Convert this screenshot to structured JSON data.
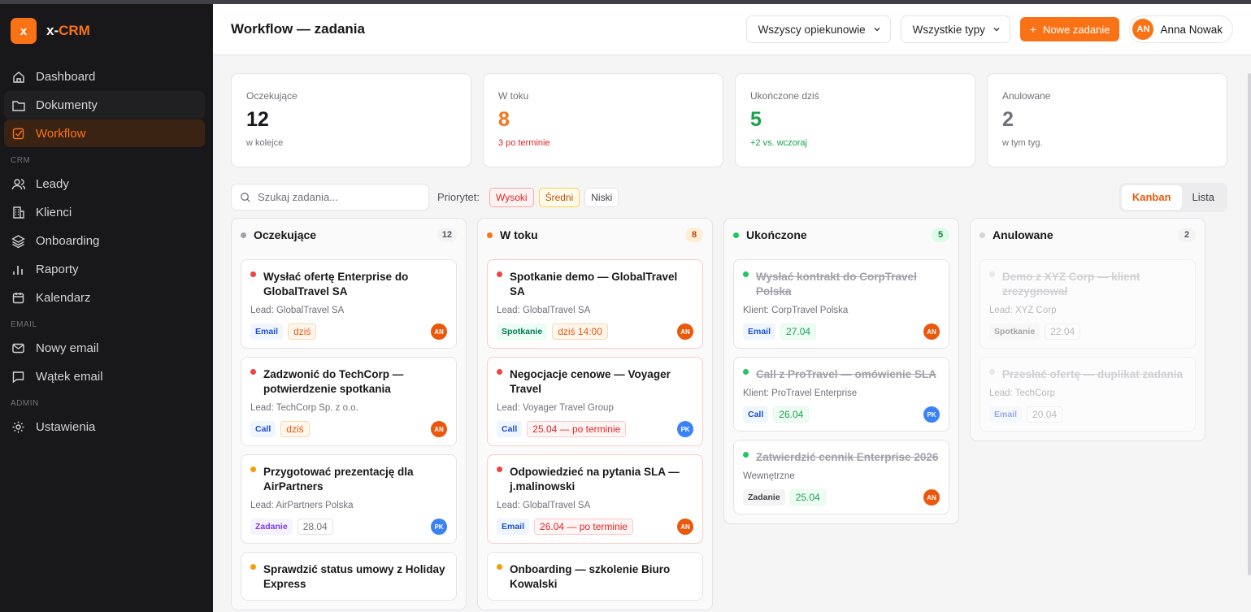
{
  "brand": {
    "logo": "x",
    "name_prefix": "x-",
    "name_accent": "CRM"
  },
  "sidebar": {
    "items": [
      {
        "label": "Dashboard",
        "icon": "home-icon"
      },
      {
        "label": "Dokumenty",
        "icon": "folder-icon"
      },
      {
        "label": "Workflow",
        "icon": "checkbox-icon",
        "active": true
      }
    ],
    "crm_section": "CRM",
    "crm_items": [
      {
        "label": "Leady",
        "icon": "users-icon"
      },
      {
        "label": "Klienci",
        "icon": "building-icon"
      },
      {
        "label": "Onboarding",
        "icon": "layers-icon"
      },
      {
        "label": "Raporty",
        "icon": "bar-chart-icon"
      },
      {
        "label": "Kalendarz",
        "icon": "calendar-icon"
      }
    ],
    "email_section": "EMAIL",
    "email_items": [
      {
        "label": "Nowy email",
        "icon": "mail-icon"
      },
      {
        "label": "Wątek email",
        "icon": "message-icon"
      }
    ],
    "admin_section": "ADMIN",
    "admin_items": [
      {
        "label": "Ustawienia",
        "icon": "gear-icon"
      }
    ]
  },
  "header": {
    "title": "Workflow — zadania",
    "filter_owner": "Wszyscy opiekunowie",
    "filter_type": "Wszystkie typy",
    "new_button": "Nowe zadanie",
    "user_initials": "AN",
    "user_name": "Anna Nowak"
  },
  "stats": [
    {
      "label": "Oczekujące",
      "value": "12",
      "sub": "w kolejce",
      "color": "#18181b",
      "sub_color": "#71717a"
    },
    {
      "label": "W toku",
      "value": "8",
      "sub": "3 po terminie",
      "color": "#f97316",
      "sub_color": "#dc2626"
    },
    {
      "label": "Ukończone dziś",
      "value": "5",
      "sub": "+2 vs. wczoraj",
      "color": "#16a34a",
      "sub_color": "#16a34a"
    },
    {
      "label": "Anulowane",
      "value": "2",
      "sub": "w tym tyg.",
      "color": "#71717a",
      "sub_color": "#71717a"
    }
  ],
  "filters": {
    "search_placeholder": "Szukaj zadania...",
    "priority_label": "Priorytet:",
    "priority_high": "Wysoki",
    "priority_mid": "Średni",
    "priority_low": "Niski",
    "view_kanban": "Kanban",
    "view_list": "Lista"
  },
  "columns": [
    {
      "title": "Oczekujące",
      "count": "12",
      "dot": "#a1a1aa",
      "count_bg": "#f4f4f5",
      "count_fg": "#52525b",
      "cards": [
        {
          "title": "Wysłać ofertę Enterprise do GlobalTravel SA",
          "prio": "#ef4444",
          "sub": "Lead: GlobalTravel SA",
          "tag": "Email",
          "tag_cls": "email",
          "date": "dziś",
          "date_cls": "orange",
          "avatar": "AN"
        },
        {
          "title": "Zadzwonić do TechCorp — potwierdzenie spotkania",
          "prio": "#ef4444",
          "sub": "Lead: TechCorp Sp. z o.o.",
          "tag": "Call",
          "tag_cls": "call",
          "date": "dziś",
          "date_cls": "orange",
          "avatar": "AN"
        },
        {
          "title": "Przygotować prezentację dla AirPartners",
          "prio": "#f59e0b",
          "sub": "Lead: AirPartners Polska",
          "tag": "Zadanie",
          "tag_cls": "task",
          "date": "28.04",
          "date_cls": "",
          "avatar": "PK"
        },
        {
          "title": "Sprawdzić status umowy z Holiday Express",
          "prio": "#f59e0b",
          "sub": "",
          "tag": "",
          "tag_cls": "",
          "date": "",
          "date_cls": "",
          "avatar": ""
        }
      ]
    },
    {
      "title": "W toku",
      "count": "8",
      "dot": "#f97316",
      "count_bg": "#ffedd5",
      "count_fg": "#c2410c",
      "cards": [
        {
          "title": "Spotkanie demo — GlobalTravel SA",
          "prio": "#ef4444",
          "sub": "Lead: GlobalTravel SA",
          "tag": "Spotkanie",
          "tag_cls": "meet",
          "date": "dziś 14:00",
          "date_cls": "orange",
          "avatar": "AN",
          "urgent": true
        },
        {
          "title": "Negocjacje cenowe — Voyager Travel",
          "prio": "#ef4444",
          "sub": "Lead: Voyager Travel Group",
          "tag": "Call",
          "tag_cls": "call",
          "date": "25.04 — po terminie",
          "date_cls": "red",
          "avatar": "PK",
          "urgent": true
        },
        {
          "title": "Odpowiedzieć na pytania SLA — j.malinowski",
          "prio": "#ef4444",
          "sub": "Lead: GlobalTravel SA",
          "tag": "Email",
          "tag_cls": "email",
          "date": "26.04 — po terminie",
          "date_cls": "red",
          "avatar": "AN",
          "urgent": true
        },
        {
          "title": "Onboarding — szkolenie Biuro Kowalski",
          "prio": "#f59e0b",
          "sub": "",
          "tag": "",
          "tag_cls": "",
          "date": "",
          "date_cls": "",
          "avatar": ""
        }
      ]
    },
    {
      "title": "Ukończone",
      "count": "5",
      "dot": "#22c55e",
      "count_bg": "#dcfce7",
      "count_fg": "#15803d",
      "cards": [
        {
          "title": "Wysłać kontrakt do CorpTravel Polska",
          "prio": "#22c55e",
          "sub": "Klient: CorpTravel Polska",
          "tag": "Email",
          "tag_cls": "email",
          "date": "27.04",
          "date_cls": "green",
          "avatar": "AN",
          "done": true
        },
        {
          "title": "Call z ProTravel — omówienie SLA",
          "prio": "#22c55e",
          "sub": "Klient: ProTravel Enterprise",
          "tag": "Call",
          "tag_cls": "call",
          "date": "26.04",
          "date_cls": "green",
          "avatar": "PK",
          "done": true
        },
        {
          "title": "Zatwierdzić cennik Enterprise 2026",
          "prio": "#22c55e",
          "sub": "Wewnętrzne",
          "tag": "Zadanie",
          "tag_cls": "int",
          "date": "25.04",
          "date_cls": "green",
          "avatar": "AN",
          "done": true
        }
      ]
    },
    {
      "title": "Anulowane",
      "count": "2",
      "dot": "#d4d4d8",
      "count_bg": "#f4f4f5",
      "count_fg": "#52525b",
      "cards": [
        {
          "title": "Demo z XYZ Corp — klient zrezygnował",
          "prio": "#d4d4d8",
          "sub": "Lead: XYZ Corp",
          "tag": "Spotkanie",
          "tag_cls": "int",
          "date": "22.04",
          "date_cls": "",
          "avatar": "",
          "faded": true
        },
        {
          "title": "Przesłać ofertę — duplikat zadania",
          "prio": "#d4d4d8",
          "sub": "Lead: TechCorp",
          "tag": "Email",
          "tag_cls": "email",
          "date": "20.04",
          "date_cls": "",
          "avatar": "",
          "faded": true
        }
      ]
    }
  ]
}
